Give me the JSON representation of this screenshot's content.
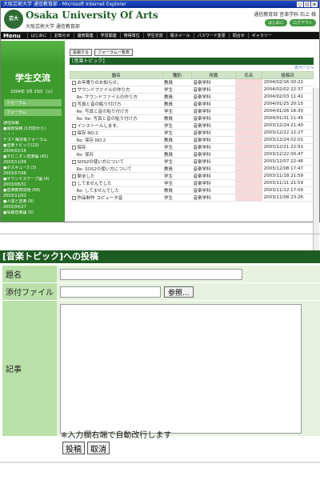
{
  "browser": {
    "title": "大阪芸術大学 通信教育部 - Microsoft Internet Explorer"
  },
  "header": {
    "logo_text": "芸大",
    "university_en": "Osaka University Of Arts",
    "university_jp": "大阪芸術大学 通信教育部",
    "department_user": "通信教育部 音楽学科 石上 様",
    "btn1": "はじめに",
    "btn2": "ログアウト"
  },
  "menu": {
    "label": "Menu",
    "items": [
      "はじめに",
      "お知らせ",
      "履修関連",
      "学習関連",
      "修得単位",
      "学生交流",
      "電子メール",
      "パスワード変更",
      "問合せ",
      "ギャラリー"
    ]
  },
  "sidebar": {
    "title": "学生交流",
    "date": "2004年 3月 23日（火）",
    "links": [
      "フォーラム",
      "フォーラム"
    ],
    "forum_lines": [
      "通信情報",
      "●最新情報 (1日前から)",
      "・・・",
      "ゲスト掲示板フォーラム",
      "●音楽トピック(23)",
      "2004/02/16",
      "●オピニオン音楽論 (41)",
      "2003/11/09",
      "●ポスキュー3 (3)",
      "2003/07/06",
      "●サウンドスケープ論 (4)",
      "2003/08/31",
      "●音楽教育問題 (58)",
      "2003/11/03",
      "●人間と音楽 (9)",
      "2003/04/27",
      "●情報音楽論 (5)"
    ]
  },
  "content": {
    "btn_post": "投稿する",
    "btn_list": "フォーラム一覧表",
    "topic_title": "[音楽トピック]",
    "next_link": "次ページ→",
    "columns": [
      "題名",
      "種別",
      "所属",
      "氏名",
      "投稿日"
    ],
    "rows": [
      {
        "title": "お年寄りのお知らせ。",
        "type": "教員",
        "dept": "音楽学科",
        "name": "",
        "date": "2004/02/16 00:22",
        "reply": false
      },
      {
        "title": "サウンドファイルの作り方",
        "type": "学生",
        "dept": "音楽学科",
        "name": "",
        "date": "2004/02/02 22:37",
        "reply": false
      },
      {
        "title": "Re: サウンドファイルの作り方",
        "type": "教員",
        "dept": "音楽学科",
        "name": "",
        "date": "2004/02/03 11:41",
        "reply": true
      },
      {
        "title": "写真と音の貼り付け方",
        "type": "教員",
        "dept": "音楽学科",
        "name": "",
        "date": "2004/01/25 20:15",
        "reply": false
      },
      {
        "title": "Re: 写真と音の貼り付け方",
        "type": "学生",
        "dept": "音楽学科",
        "name": "",
        "date": "2004/01/26 16:30",
        "reply": true
      },
      {
        "title": "Re: Re: 写真と音の貼り付け方",
        "type": "教員",
        "dept": "音楽学科",
        "name": "",
        "date": "2004/01/31 11:45",
        "reply": true
      },
      {
        "title": "インストールします。",
        "type": "学生",
        "dept": "音楽学科",
        "name": "",
        "date": "2003/12/24 21:40",
        "reply": false
      },
      {
        "title": "保存 NO.2",
        "type": "学生",
        "dept": "音楽学科",
        "name": "",
        "date": "2003/12/22 22:27",
        "reply": false
      },
      {
        "title": "Re: 保存 NO.2",
        "type": "教員",
        "dept": "音楽学科",
        "name": "",
        "date": "2003/12/24 02:01",
        "reply": true
      },
      {
        "title": "保存",
        "type": "学生",
        "dept": "音楽学科",
        "name": "",
        "date": "2003/12/21 22:51",
        "reply": false
      },
      {
        "title": "Re: 保存",
        "type": "教員",
        "dept": "音楽学科",
        "name": "",
        "date": "2003/12/22 00:47",
        "reply": true
      },
      {
        "title": "SOS2の使い方について",
        "type": "学生",
        "dept": "音楽学科",
        "name": "",
        "date": "2003/12/07 22:46",
        "reply": false
      },
      {
        "title": "Re: SOS2の使い方について",
        "type": "教員",
        "dept": "音楽学科",
        "name": "",
        "date": "2003/12/08 17:47",
        "reply": true
      },
      {
        "title": "閉ました",
        "type": "学生",
        "dept": "音楽学科",
        "name": "",
        "date": "2003/11/18 21:59",
        "reply": false
      },
      {
        "title": "してませんでした",
        "type": "学生",
        "dept": "音楽学科",
        "name": "",
        "date": "2003/11/11 21:59",
        "reply": false
      },
      {
        "title": "Re: してませんでした",
        "type": "教員",
        "dept": "音楽学科",
        "name": "",
        "date": "2003/11/12 17:09",
        "reply": true
      },
      {
        "title": "作品制作 コピュータ音",
        "type": "学生",
        "dept": "音楽学科",
        "name": "",
        "date": "2003/11/08 23:26",
        "reply": false
      }
    ]
  },
  "form": {
    "title": "[音楽トピック]への投稿",
    "label_subject": "題名",
    "label_file": "添付ファイル",
    "browse_button": "参照...",
    "label_body": "記事",
    "note": "※入力欄右端で自動改行します",
    "submit": "投稿",
    "cancel": "取消"
  }
}
